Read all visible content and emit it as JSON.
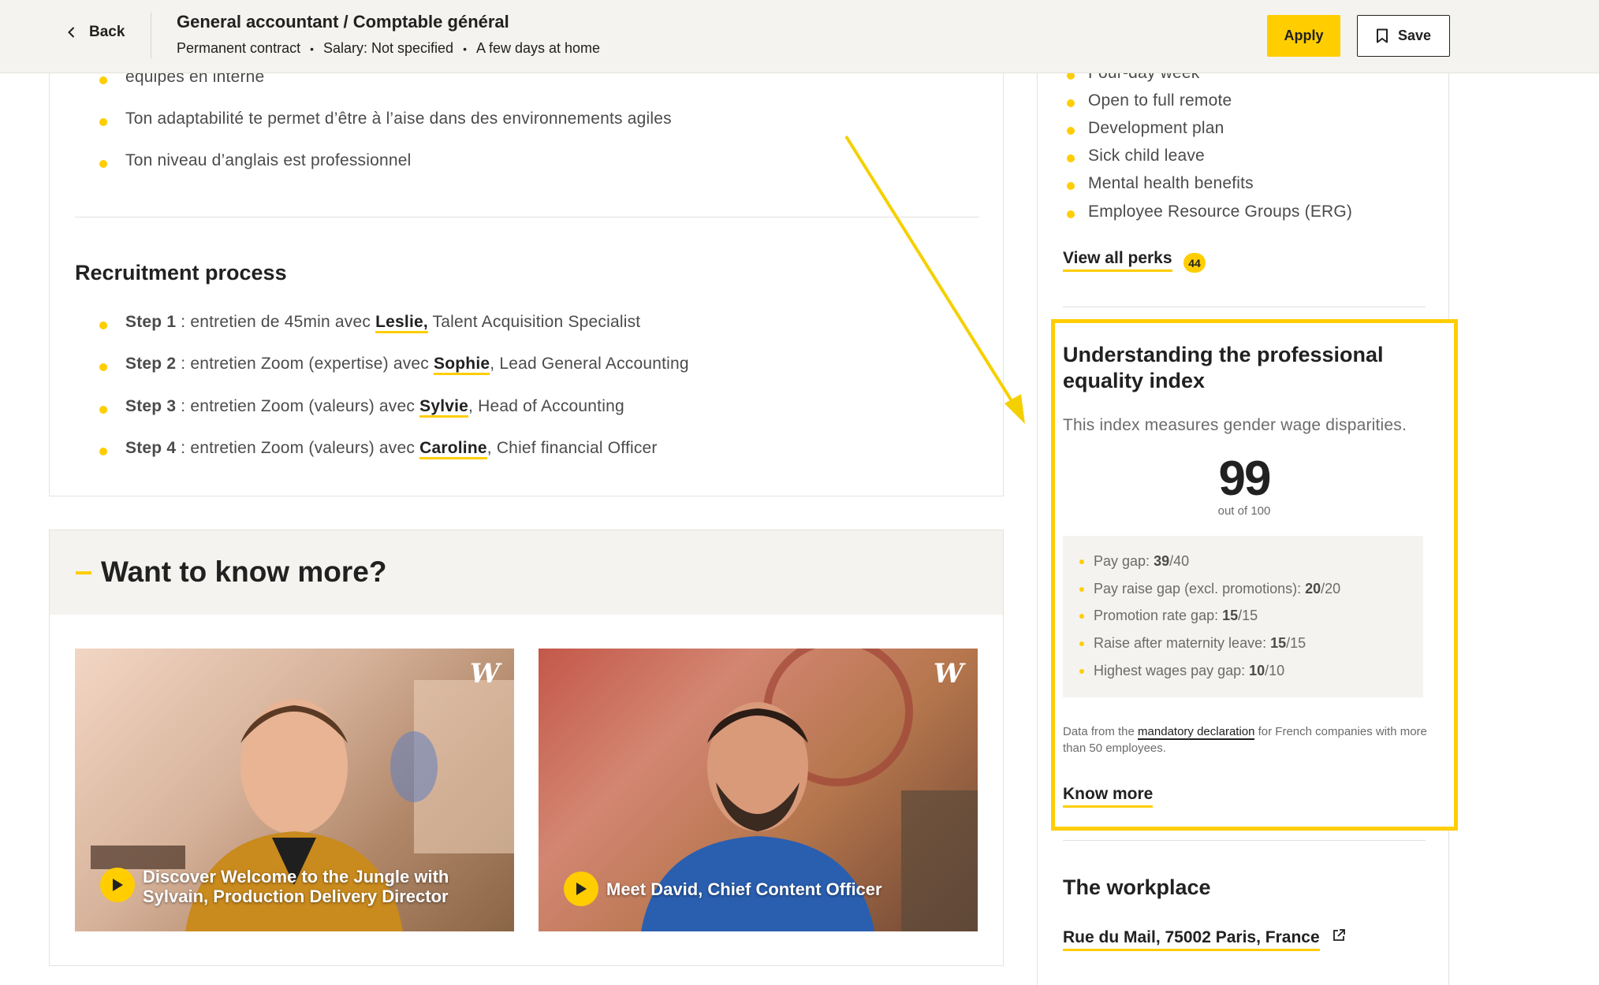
{
  "header": {
    "back_label": "Back",
    "job_title": "General accountant / Comptable général",
    "meta": [
      "Permanent contract",
      "Salary: Not specified",
      "A few days at home"
    ],
    "apply_label": "Apply",
    "save_label": "Save"
  },
  "description": {
    "partial_line": "équipes en interne",
    "bullets": [
      "Ton adaptabilité te permet d’être à l’aise dans des environnements agiles",
      "Ton niveau d’anglais est professionnel"
    ]
  },
  "recruitment": {
    "title": "Recruitment process",
    "steps": [
      {
        "label": "Step 1",
        "text_before": " : entretien de 45min avec ",
        "person": "Leslie,",
        "text_after": " Talent Acquisition Specialist"
      },
      {
        "label": "Step 2",
        "text_before": " : entretien Zoom (expertise) avec ",
        "person": "Sophie",
        "text_after": ", Lead General Accounting"
      },
      {
        "label": "Step 3",
        "text_before": " : entretien Zoom (valeurs) avec ",
        "person": "Sylvie",
        "text_after": ", Head of Accounting"
      },
      {
        "label": "Step 4",
        "text_before": " : entretien Zoom (valeurs) avec ",
        "person": "Caroline",
        "text_after": ", Chief financial Officer"
      }
    ]
  },
  "more": {
    "title": "Want to know more?",
    "videos": [
      {
        "caption_line1": "Discover Welcome to the Jungle with",
        "caption_line2": "Sylvain, Production Delivery Director",
        "logo": "W"
      },
      {
        "caption_line1": "Meet David, Chief Content Officer",
        "logo": "W"
      }
    ]
  },
  "perks": {
    "partial_item": "Four-day week",
    "items": [
      "Open to full remote",
      "Development plan",
      "Sick child leave",
      "Mental health benefits",
      "Employee Resource Groups (ERG)"
    ],
    "view_all_label": "View all perks",
    "count": "44"
  },
  "equality": {
    "title": "Understanding the professional equality index",
    "description": "This index measures gender wage disparities.",
    "score": "99",
    "out_of": "out of 100",
    "breakdown": [
      {
        "label": "Pay gap: ",
        "value": "39",
        "max": "/40"
      },
      {
        "label": "Pay raise gap (excl. promotions): ",
        "value": "20",
        "max": "/20"
      },
      {
        "label": "Promotion rate gap: ",
        "value": "15",
        "max": "/15"
      },
      {
        "label": "Raise after maternity leave: ",
        "value": "15",
        "max": "/15"
      },
      {
        "label": "Highest wages pay gap: ",
        "value": "10",
        "max": "/10"
      }
    ],
    "note_before": "Data from the ",
    "note_link": "mandatory declaration",
    "note_after": " for French companies with more than 50 employees.",
    "know_more_label": "Know more"
  },
  "workplace": {
    "title": "The workplace",
    "address": "Rue du Mail, 75002 Paris, France"
  },
  "colors": {
    "accent": "#ffcd00",
    "header_bg": "#f4f3ef",
    "text": "#212121",
    "muted": "#4b4b4b",
    "annotation": "#f5d000"
  },
  "icons": [
    "chevron-left-icon",
    "bookmark-icon",
    "play-icon",
    "external-link-icon",
    "annotation-arrow"
  ]
}
